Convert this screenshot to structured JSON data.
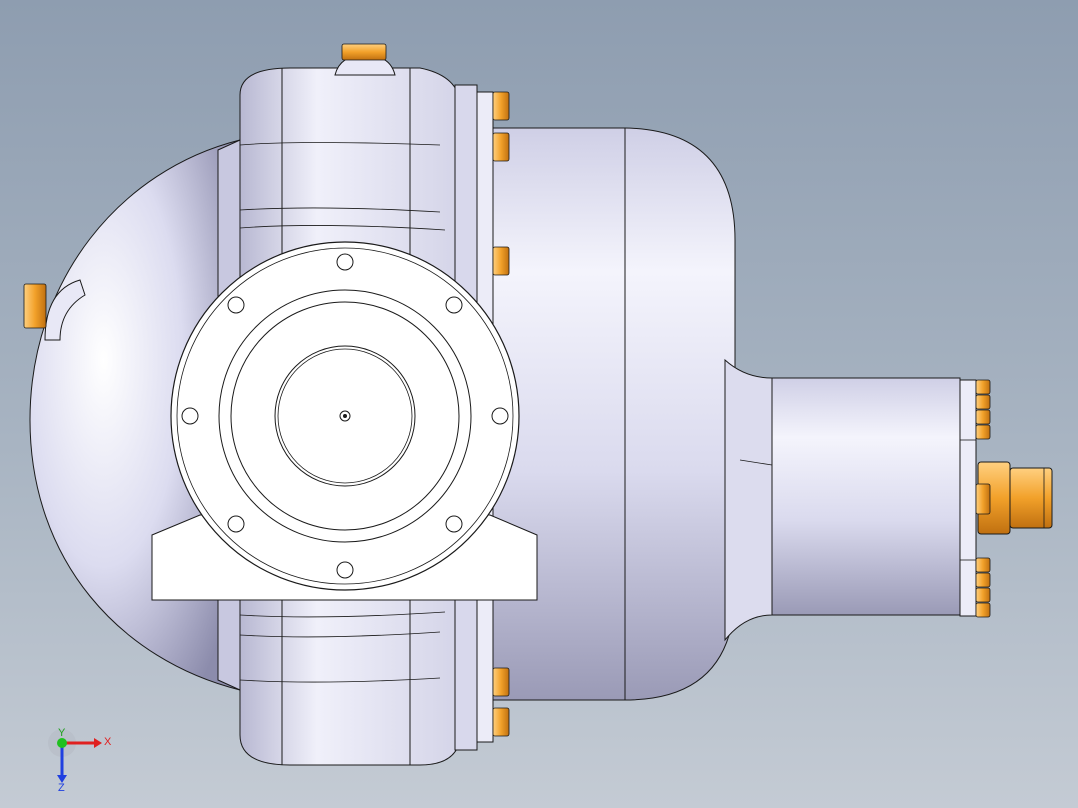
{
  "viewport": {
    "background_top": "#8e9db0",
    "background_bottom": "#c4cbd4"
  },
  "model": {
    "body_color": "#d8d8ee",
    "body_shadow": "#9a9ab8",
    "edge_color": "#1a1a1a",
    "fastener_color": "#f2a12a",
    "flange_face_color": "#ffffff"
  },
  "triad": {
    "x_label": "X",
    "y_label": "Y",
    "z_label": "Z",
    "x_color": "#e02020",
    "y_color": "#20c020",
    "z_color": "#2040e0"
  }
}
